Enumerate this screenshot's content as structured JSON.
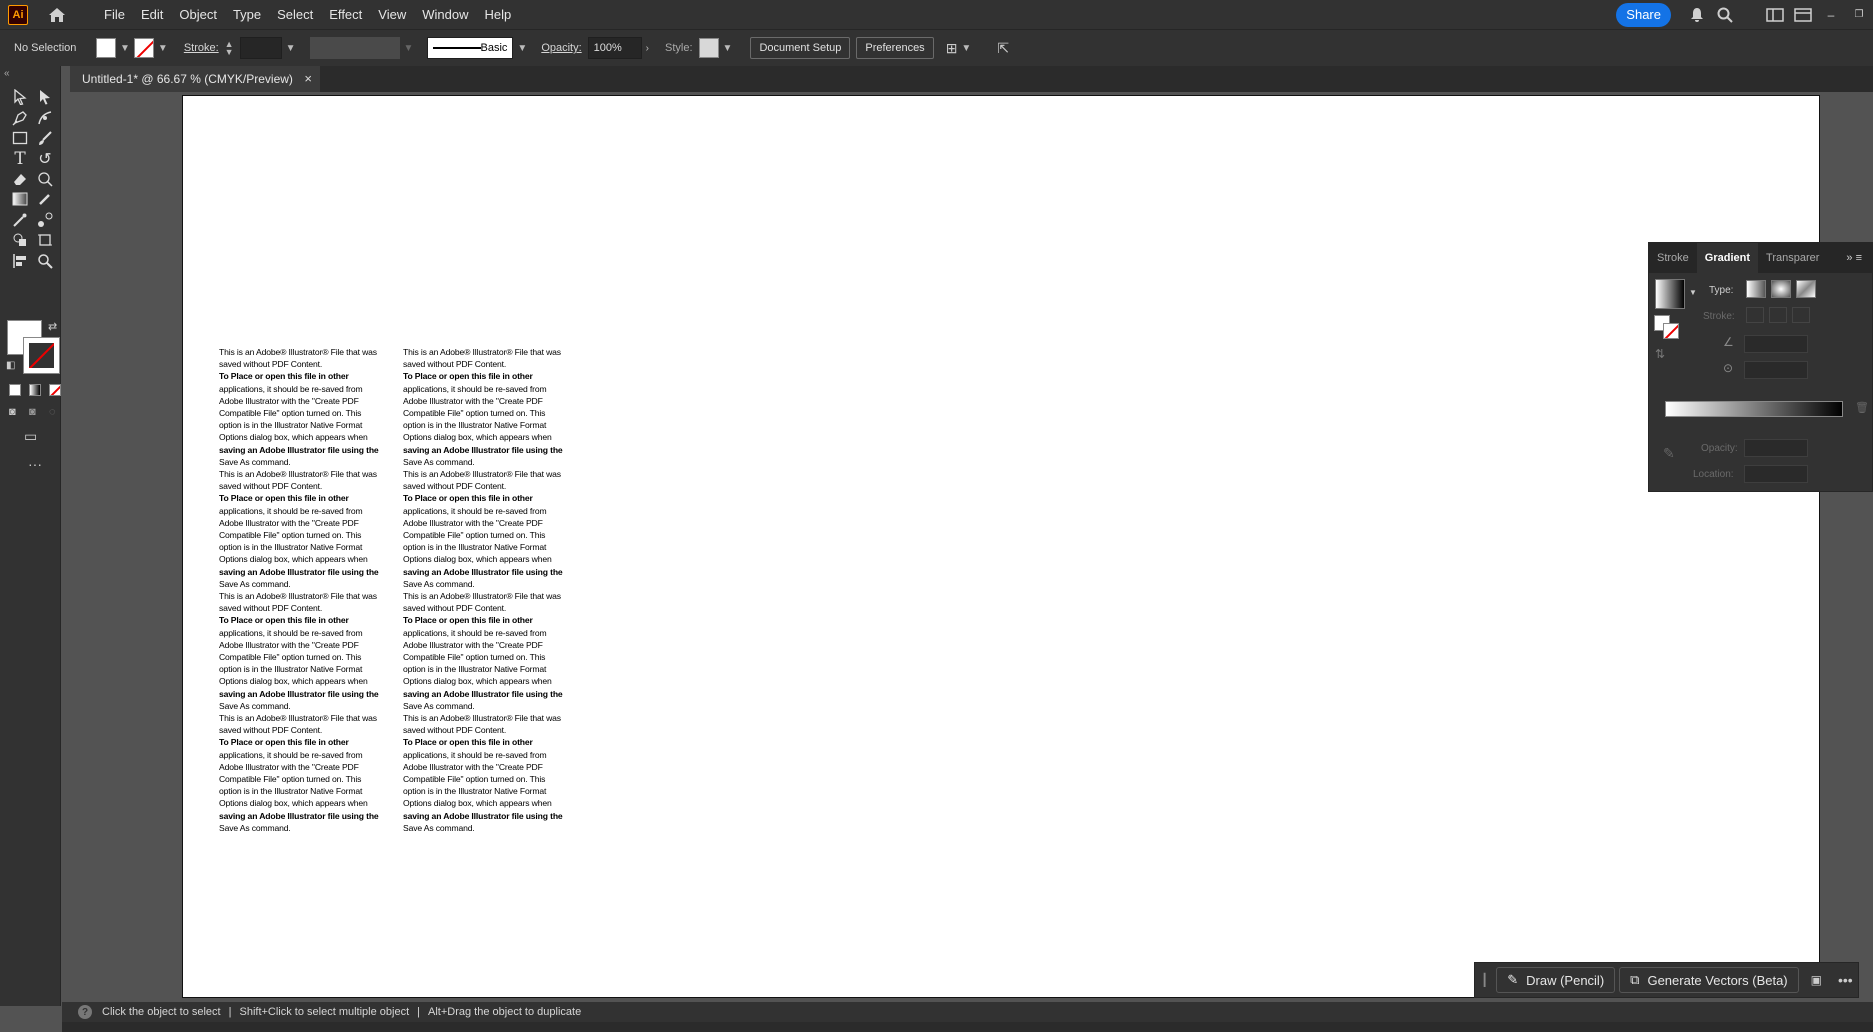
{
  "app": {
    "logo": "Ai",
    "menu": [
      "File",
      "Edit",
      "Object",
      "Type",
      "Select",
      "Effect",
      "View",
      "Window",
      "Help"
    ],
    "share_label": "Share"
  },
  "control_bar": {
    "selection": "No Selection",
    "stroke_label": "Stroke:",
    "brush_label": "Basic",
    "opacity_label": "Opacity:",
    "opacity_value": "100%",
    "style_label": "Style:",
    "document_setup": "Document Setup",
    "preferences": "Preferences"
  },
  "document": {
    "tab_title": "Untitled-1* @ 66.67 % (CMYK/Preview)",
    "close_glyph": "×"
  },
  "artboard_text": {
    "line1": "This is an Adobe® Illustrator® File that was",
    "line2": "saved without PDF Content.",
    "line3": "To Place or open this file in other",
    "line4": "applications, it should be re-saved from",
    "line5": "Adobe Illustrator with the \"Create PDF",
    "line6": "Compatible File\" option turned on. This",
    "line7": "option is in the Illustrator Native Format",
    "line8": "Options dialog box, which appears when",
    "line9": "saving an Adobe Illustrator file using the",
    "line10": "Save As command."
  },
  "gradient_panel": {
    "tabs": [
      "Stroke",
      "Gradient",
      "Transparer"
    ],
    "type_label": "Type:",
    "stroke_label": "Stroke:",
    "opacity_label": "Opacity:",
    "location_label": "Location:"
  },
  "floating_bar": {
    "draw_label": "Draw (Pencil)",
    "generate_label": "Generate Vectors (Beta)"
  },
  "status": {
    "hint1": "Click the object to select",
    "hint2": "Shift+Click to select multiple object",
    "hint3": "Alt+Drag the object to duplicate",
    "separator": "|"
  },
  "colors": {
    "accent": "#1473e6",
    "panel": "#323232",
    "workspace": "#535353",
    "logo_orange": "#ff9a00"
  },
  "icons": [
    "home-icon",
    "bell-icon",
    "search-icon",
    "workspace-icon",
    "arrange-icon",
    "selection-tool-icon",
    "direct-selection-tool-icon",
    "pen-tool-icon",
    "curvature-tool-icon",
    "rectangle-tool-icon",
    "paintbrush-tool-icon",
    "type-tool-icon",
    "rotate-tool-icon",
    "eraser-tool-icon",
    "shape-builder-icon",
    "gradient-tool-icon",
    "eyedropper-tool-icon",
    "zoom-tool-icon"
  ]
}
